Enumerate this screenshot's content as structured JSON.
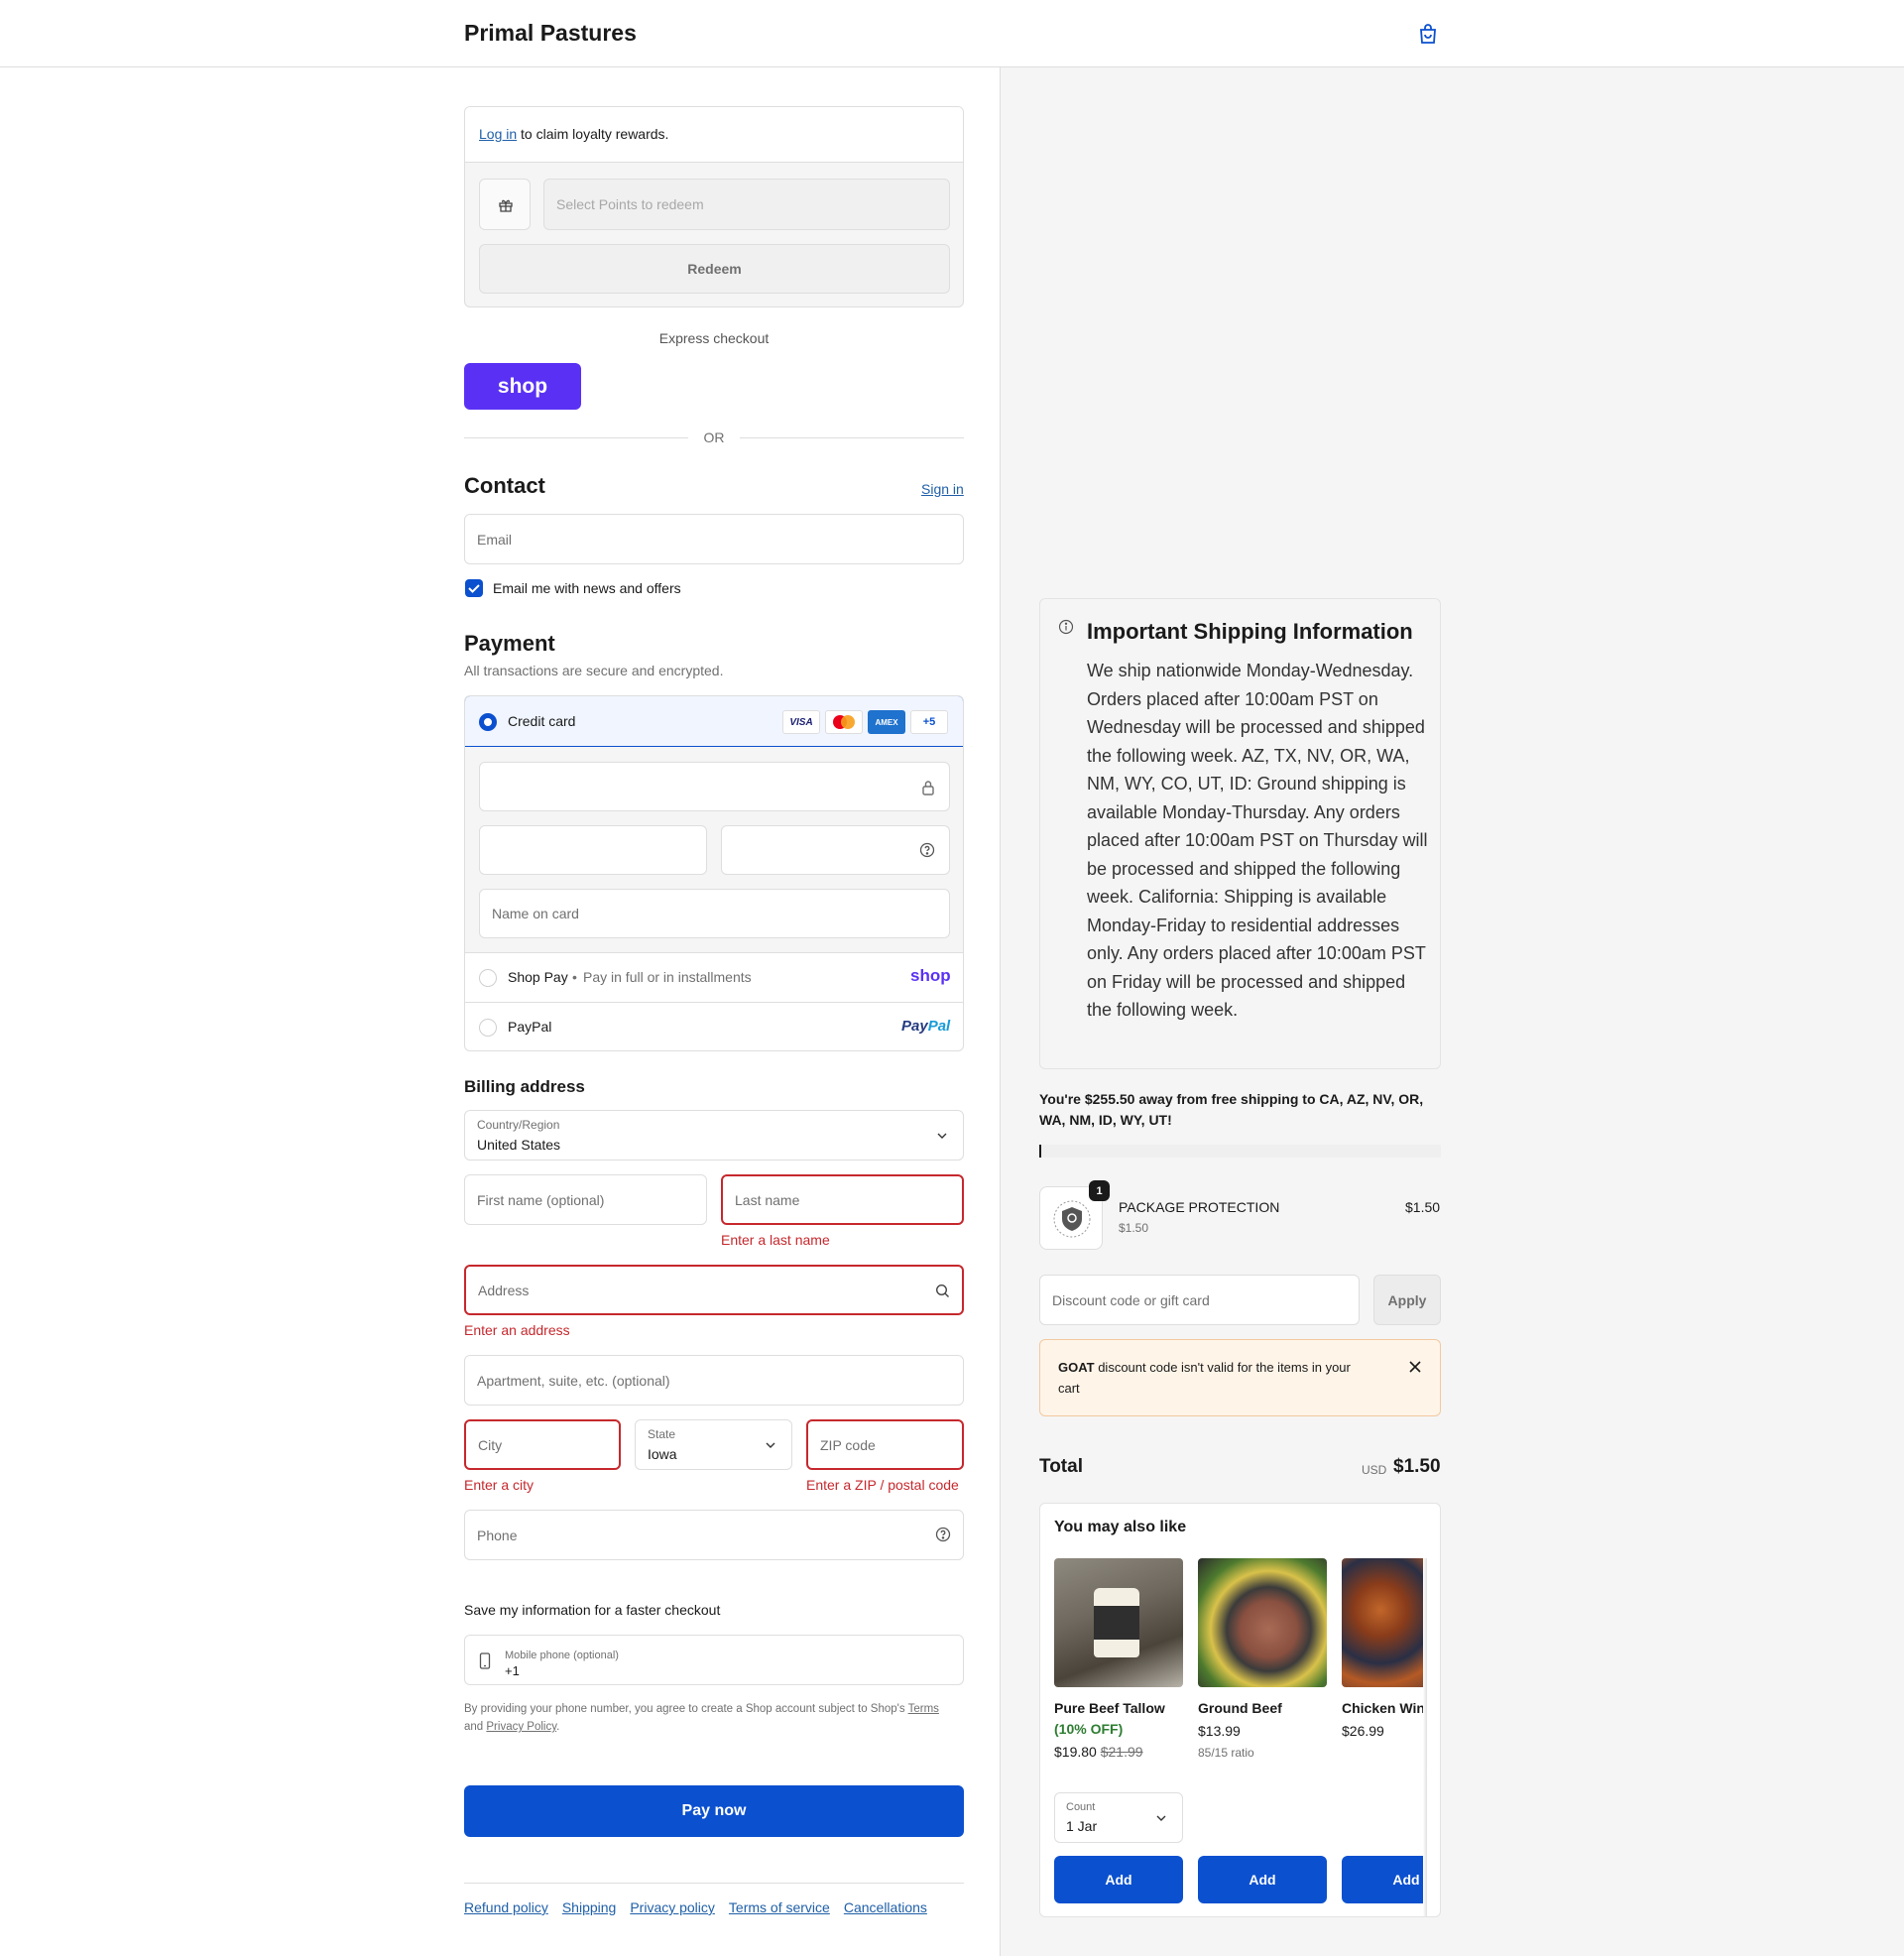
{
  "header": {
    "brand": "Primal Pastures"
  },
  "loyalty": {
    "login_link": "Log in",
    "login_text": " to claim loyalty rewards.",
    "points_placeholder": "Select Points to redeem",
    "redeem_label": "Redeem"
  },
  "express": {
    "label": "Express checkout",
    "shop_label": "shop",
    "or_label": "OR"
  },
  "contact": {
    "title": "Contact",
    "sign_in": "Sign in",
    "email_placeholder": "Email",
    "news_label": "Email me with news and offers",
    "news_checked": true
  },
  "payment": {
    "title": "Payment",
    "subtitle": "All transactions are secure and encrypted.",
    "credit_card_label": "Credit card",
    "card_brands": [
      "VISA",
      "Mastercard",
      "AMEX",
      "+5"
    ],
    "name_on_card_placeholder": "Name on card",
    "shop_pay_label": "Shop Pay",
    "shop_pay_sub": "Pay in full or in installments",
    "shop_pay_logo": "shop",
    "paypal_label": "PayPal",
    "paypal_logo_a": "Pay",
    "paypal_logo_b": "Pal",
    "selected": "Credit card"
  },
  "billing": {
    "title": "Billing address",
    "country_label": "Country/Region",
    "country_value": "United States",
    "first_name_placeholder": "First name (optional)",
    "last_name_placeholder": "Last name",
    "last_name_error": "Enter a last name",
    "address_placeholder": "Address",
    "address_error": "Enter an address",
    "apartment_placeholder": "Apartment, suite, etc. (optional)",
    "city_placeholder": "City",
    "city_error": "Enter a city",
    "state_label": "State",
    "state_value": "Iowa",
    "zip_placeholder": "ZIP code",
    "zip_error": "Enter a ZIP / postal code",
    "phone_placeholder": "Phone"
  },
  "save_info": {
    "title": "Save my information for a faster checkout",
    "mobile_label": "Mobile phone (optional)",
    "mobile_value": "+1",
    "legal_prefix": "By providing your phone number, you agree to create a Shop account subject to Shop's ",
    "legal_terms": "Terms",
    "legal_and": "and ",
    "legal_privacy": "Privacy Policy",
    "legal_suffix": "."
  },
  "pay_now": "Pay now",
  "footer_links": [
    "Refund policy",
    "Shipping",
    "Privacy policy",
    "Terms of service",
    "Cancellations"
  ],
  "shipping_info": {
    "title": "Important Shipping Information",
    "body": "We ship nationwide Monday-Wednesday. Orders placed after 10:00am PST on Wednesday will be processed and shipped the following week. AZ, TX, NV, OR, WA, NM, WY, CO, UT, ID: Ground shipping is available Monday-Thursday. Any orders placed after 10:00am PST on Thursday will be processed and shipped the following week. California: Shipping is available Monday-Friday to residential addresses only. Any orders placed after 10:00am PST on Friday will be processed and shipped the following week."
  },
  "free_shipping": {
    "text": "You're $255.50 away from free shipping to CA, AZ, NV, OR, WA, NM, ID, WY, UT!",
    "progress": 0.0
  },
  "cart_item": {
    "name": "PACKAGE PROTECTION",
    "unit_price": "$1.50",
    "price": "$1.50",
    "quantity": "1"
  },
  "discount": {
    "placeholder": "Discount code or gift card",
    "apply_label": "Apply",
    "notice_code": "GOAT",
    "notice_text": " discount code isn't valid for the items in your cart"
  },
  "total": {
    "label": "Total",
    "currency": "USD",
    "amount": "$1.50"
  },
  "upsell": {
    "title": "You may also like",
    "products": [
      {
        "name": "Pure Beef Tallow",
        "discount": "(10% OFF)",
        "price": "$19.80",
        "compare_price": "$21.99",
        "count_label": "Count",
        "count_value": "1 Jar",
        "add_label": "Add"
      },
      {
        "name": "Ground Beef",
        "price": "$13.99",
        "note": "85/15 ratio",
        "add_label": "Add"
      },
      {
        "name": "Chicken Wings",
        "price": "$26.99",
        "add_label": "Add"
      }
    ]
  },
  "colors": {
    "accent": "#0b50cf",
    "error": "#c6282d",
    "shop_purple": "#5a31f4",
    "discount_green": "#2e7d32"
  }
}
